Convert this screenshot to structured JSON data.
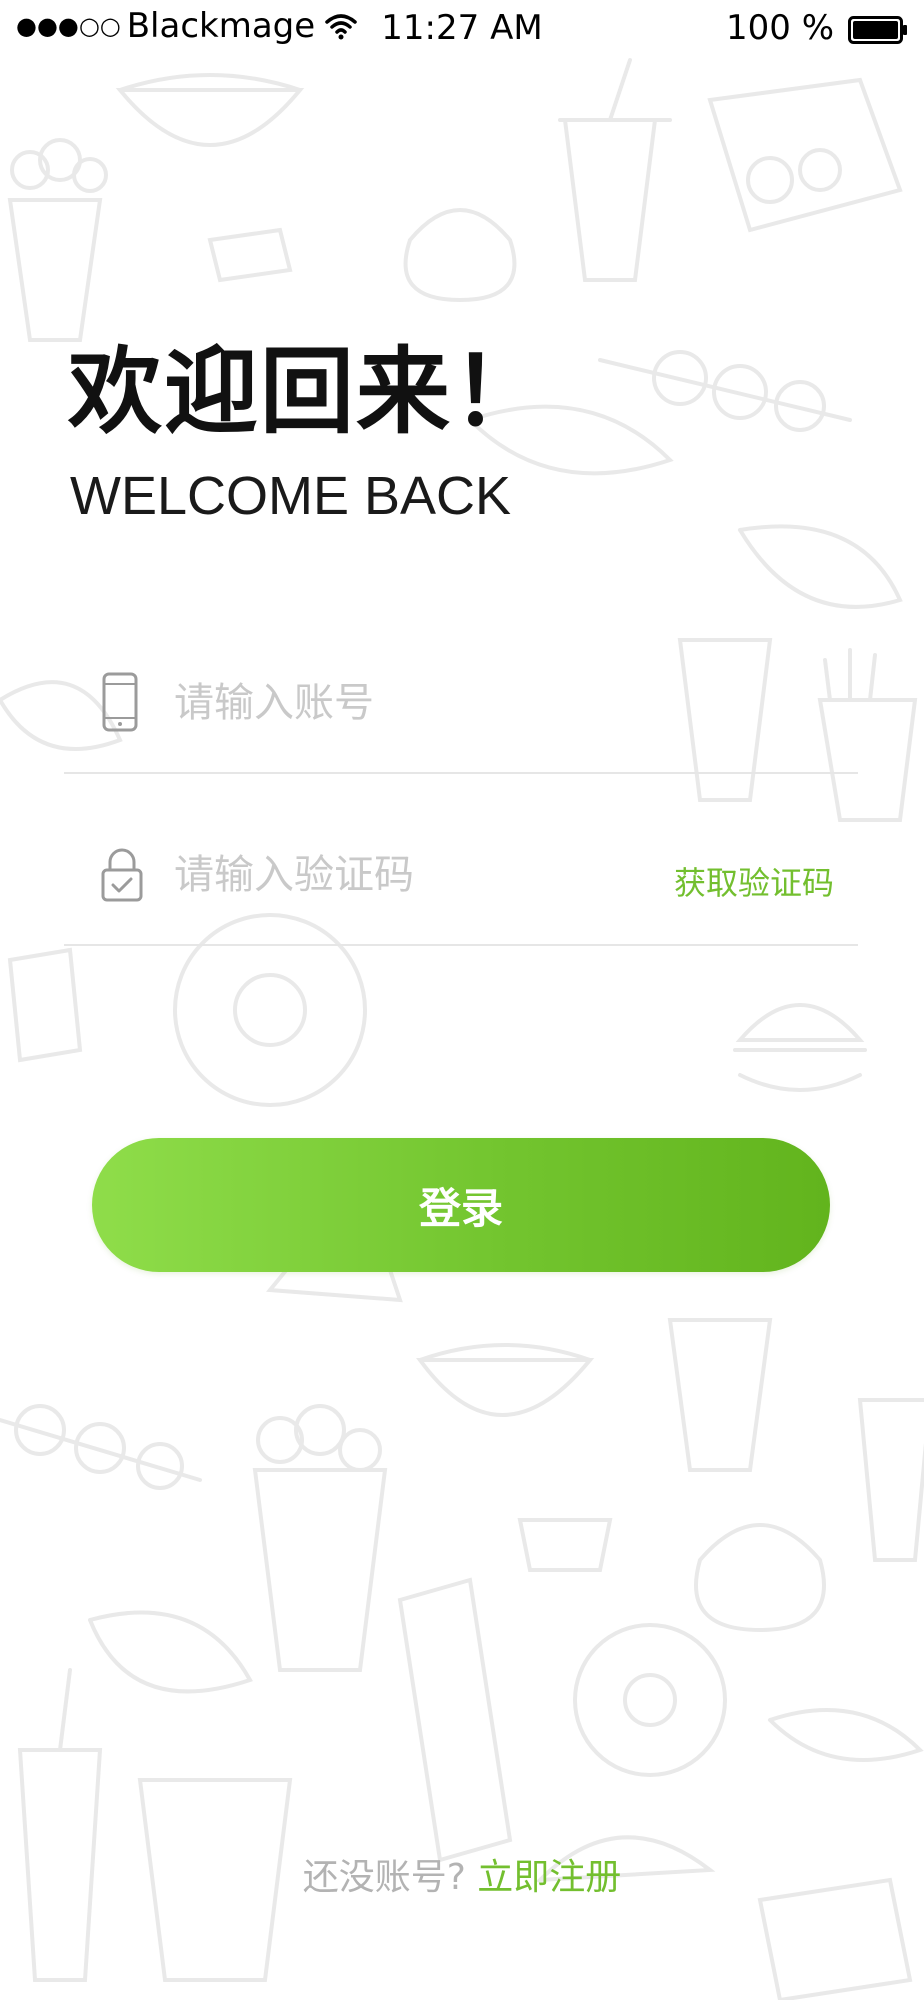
{
  "status_bar": {
    "carrier": "Blackmage",
    "signal_dots": "●●●○○",
    "time": "11:27 AM",
    "battery": "100 %",
    "icons": [
      "wifi-icon",
      "battery-icon"
    ]
  },
  "header": {
    "title_cn": "欢迎回来！",
    "title_en": "WELCOME BACK"
  },
  "form": {
    "account": {
      "placeholder": "请输入账号",
      "value": "",
      "icon": "phone-icon"
    },
    "code": {
      "placeholder": "请输入验证码",
      "value": "",
      "icon": "lock-icon",
      "get_code_label": "获取验证码"
    },
    "login_label": "登录"
  },
  "footer": {
    "prompt": "还没账号?",
    "register_label": "立即注册"
  },
  "colors": {
    "accent": "#73bf2f",
    "button_gradient_start": "#8fdd4a",
    "button_gradient_end": "#62b41d",
    "placeholder": "#c9c9c9",
    "divider": "#e6e6e6"
  }
}
